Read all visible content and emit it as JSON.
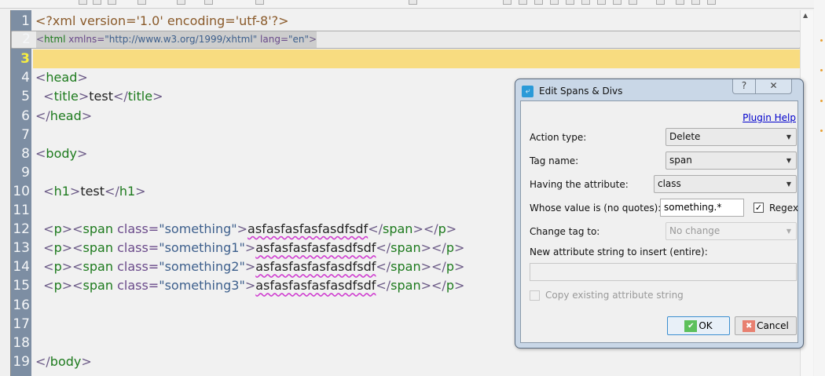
{
  "editor": {
    "current_line": 3,
    "selected_line": 2,
    "lines": [
      [
        [
          "decl",
          "<?xml version='1.0' encoding='utf-8'?>"
        ]
      ],
      [
        [
          "br",
          "<"
        ],
        [
          "tag",
          "html"
        ],
        [
          "an",
          " xmlns="
        ],
        [
          "av",
          "\"http://www.w3.org/1999/xhtml\""
        ],
        [
          "an",
          " lang="
        ],
        [
          "av",
          "\"en\""
        ],
        [
          "br",
          ">"
        ]
      ],
      [],
      [
        [
          "br",
          "<"
        ],
        [
          "tag",
          "head"
        ],
        [
          "br",
          ">"
        ]
      ],
      [
        [
          "tx",
          "  "
        ],
        [
          "br",
          "<"
        ],
        [
          "tag",
          "title"
        ],
        [
          "br",
          ">"
        ],
        [
          "tx",
          "test"
        ],
        [
          "br",
          "</"
        ],
        [
          "tag",
          "title"
        ],
        [
          "br",
          ">"
        ]
      ],
      [
        [
          "br",
          "</"
        ],
        [
          "tag",
          "head"
        ],
        [
          "br",
          ">"
        ]
      ],
      [],
      [
        [
          "br",
          "<"
        ],
        [
          "tag",
          "body"
        ],
        [
          "br",
          ">"
        ]
      ],
      [],
      [
        [
          "tx",
          "  "
        ],
        [
          "br",
          "<"
        ],
        [
          "tag",
          "h1"
        ],
        [
          "br",
          ">"
        ],
        [
          "tx",
          "test"
        ],
        [
          "br",
          "</"
        ],
        [
          "tag",
          "h1"
        ],
        [
          "br",
          ">"
        ]
      ],
      [],
      [
        [
          "tx",
          "  "
        ],
        [
          "br",
          "<"
        ],
        [
          "tag",
          "p"
        ],
        [
          "br",
          "><"
        ],
        [
          "tag",
          "span"
        ],
        [
          "an",
          " class="
        ],
        [
          "av",
          "\"something\""
        ],
        [
          "br",
          ">"
        ],
        [
          "sq",
          "asfasfasfasfasdfsdf"
        ],
        [
          "br",
          "</"
        ],
        [
          "tag",
          "span"
        ],
        [
          "br",
          "></"
        ],
        [
          "tag",
          "p"
        ],
        [
          "br",
          ">"
        ]
      ],
      [
        [
          "tx",
          "  "
        ],
        [
          "br",
          "<"
        ],
        [
          "tag",
          "p"
        ],
        [
          "br",
          "><"
        ],
        [
          "tag",
          "span"
        ],
        [
          "an",
          " class="
        ],
        [
          "av",
          "\"something1\""
        ],
        [
          "br",
          ">"
        ],
        [
          "sq",
          "asfasfasfasfasdfsdf"
        ],
        [
          "br",
          "</"
        ],
        [
          "tag",
          "span"
        ],
        [
          "br",
          "></"
        ],
        [
          "tag",
          "p"
        ],
        [
          "br",
          ">"
        ]
      ],
      [
        [
          "tx",
          "  "
        ],
        [
          "br",
          "<"
        ],
        [
          "tag",
          "p"
        ],
        [
          "br",
          "><"
        ],
        [
          "tag",
          "span"
        ],
        [
          "an",
          " class="
        ],
        [
          "av",
          "\"something2\""
        ],
        [
          "br",
          ">"
        ],
        [
          "sq",
          "asfasfasfasfasdfsdf"
        ],
        [
          "br",
          "</"
        ],
        [
          "tag",
          "span"
        ],
        [
          "br",
          "></"
        ],
        [
          "tag",
          "p"
        ],
        [
          "br",
          ">"
        ]
      ],
      [
        [
          "tx",
          "  "
        ],
        [
          "br",
          "<"
        ],
        [
          "tag",
          "p"
        ],
        [
          "br",
          "><"
        ],
        [
          "tag",
          "span"
        ],
        [
          "an",
          " class="
        ],
        [
          "av",
          "\"something3\""
        ],
        [
          "br",
          ">"
        ],
        [
          "sq",
          "asfasfasfasfasdfsdf"
        ],
        [
          "br",
          "</"
        ],
        [
          "tag",
          "span"
        ],
        [
          "br",
          "></"
        ],
        [
          "tag",
          "p"
        ],
        [
          "br",
          ">"
        ]
      ],
      [],
      [],
      [],
      [
        [
          "br",
          "</"
        ],
        [
          "tag",
          "body"
        ],
        [
          "br",
          ">"
        ]
      ]
    ]
  },
  "dialog": {
    "title": "Edit Spans & Divs",
    "help_button": "?",
    "close_button": "✕",
    "plugin_help": "Plugin Help",
    "action_type_label": "Action type:",
    "action_type_value": "Delete",
    "tag_name_label": "Tag name:",
    "tag_name_value": "span",
    "attribute_label": "Having the attribute:",
    "attribute_value": "class",
    "value_label": "Whose value is (no quotes):",
    "value_input": "something.*",
    "regex_label": "Regex",
    "regex_checked": true,
    "change_tag_label": "Change tag to:",
    "change_tag_value": "No change",
    "new_attr_label": "New attribute string to insert (entire):",
    "new_attr_value": "",
    "copy_label": "Copy existing attribute string",
    "ok_label": "OK",
    "cancel_label": "Cancel",
    "check_mark": "✓"
  }
}
